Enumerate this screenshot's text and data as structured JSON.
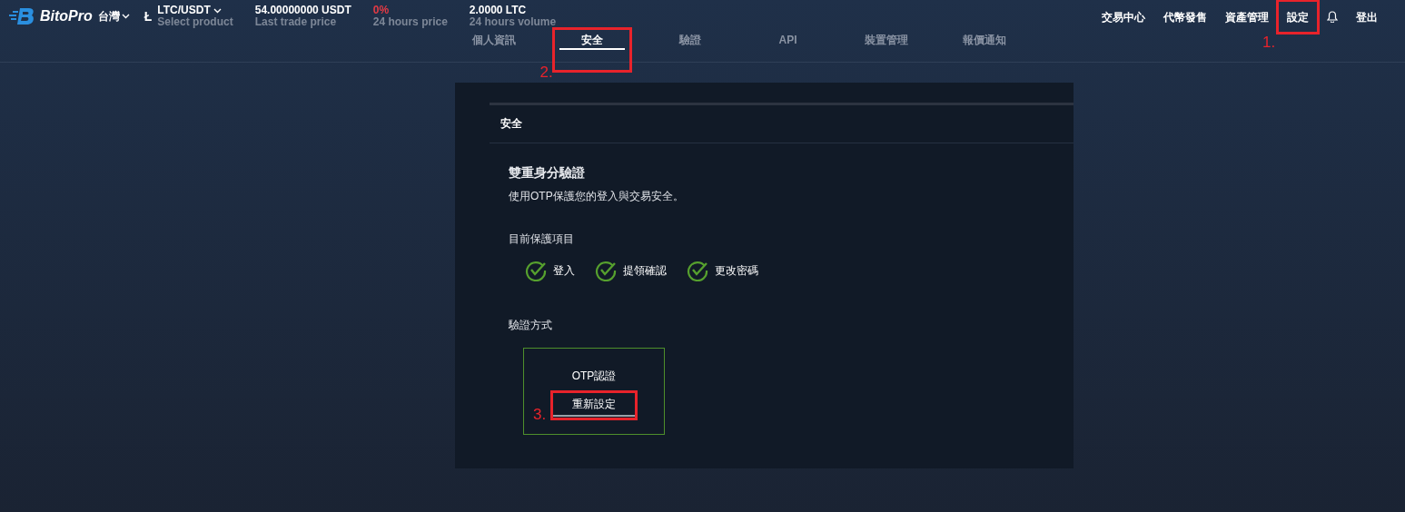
{
  "header": {
    "brand": "BitoPro",
    "region": "台灣",
    "coin_symbol": "Ł",
    "pair": {
      "value": "LTC/USDT",
      "label": "Select product"
    },
    "stats": [
      {
        "value": "54.00000000 USDT",
        "label": "Last trade price",
        "kind": "plain"
      },
      {
        "value": "0%",
        "label": "24 hours price",
        "kind": "change"
      },
      {
        "value": "2.0000 LTC",
        "label": "24 hours volume",
        "kind": "plain"
      }
    ],
    "nav": [
      {
        "label": "交易中心",
        "kind": "link"
      },
      {
        "label": "代幣發售",
        "kind": "link"
      },
      {
        "label": "資產管理",
        "kind": "link"
      },
      {
        "label": "設定",
        "kind": "link",
        "annotation": "1."
      },
      {
        "kind": "bell"
      },
      {
        "label": "登出",
        "kind": "link"
      }
    ]
  },
  "tabs": [
    {
      "label": "個人資訊",
      "selected": false
    },
    {
      "label": "安全",
      "selected": true,
      "annotation": "2."
    },
    {
      "label": "驗證",
      "selected": false
    },
    {
      "label": "API",
      "selected": false
    },
    {
      "label": "裝置管理",
      "selected": false
    },
    {
      "label": "報價通知",
      "selected": false
    }
  ],
  "panel": {
    "title": "安全",
    "heading": "雙重身分驗證",
    "description": "使用OTP保護您的登入與交易安全。",
    "protected_label": "目前保護項目",
    "protected_items": [
      "登入",
      "提領確認",
      "更改密碼"
    ],
    "method_label": "驗證方式",
    "method": {
      "name": "OTP認證",
      "button": "重新設定",
      "annotation": "3."
    }
  }
}
